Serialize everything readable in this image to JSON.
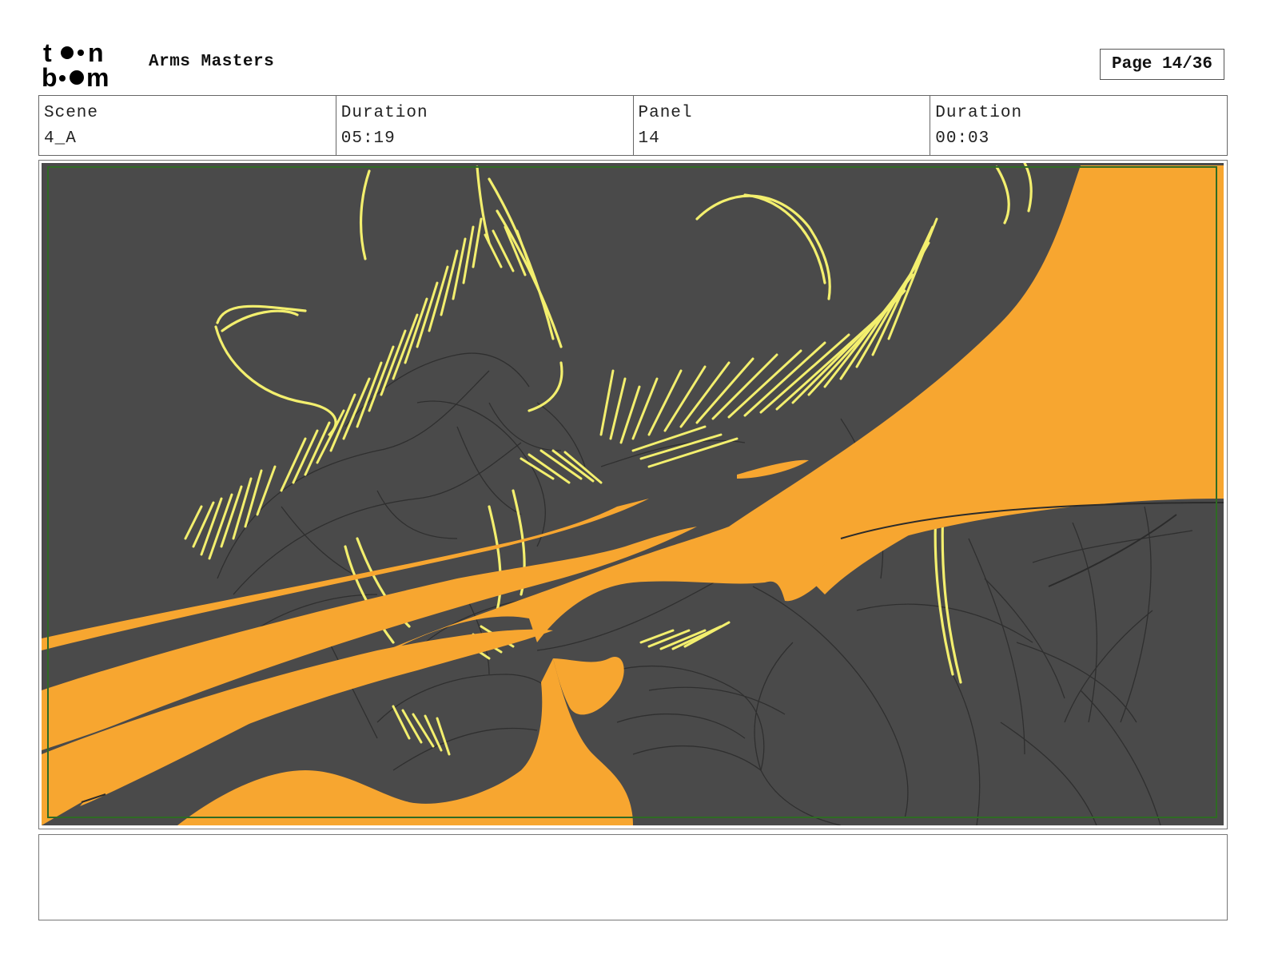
{
  "header": {
    "logo_text": "toon boom",
    "project_title": "Arms Masters",
    "page_label": "Page 14/36"
  },
  "info": {
    "scene_label": "Scene",
    "scene_value": "4_A",
    "scene_duration_label": "Duration",
    "scene_duration_value": "05:19",
    "panel_label": "Panel",
    "panel_value": "14",
    "panel_duration_label": "Duration",
    "panel_duration_value": "00:03"
  },
  "colors": {
    "background": "#4a4a4a",
    "slash": "#f7a630",
    "highlight": "#f3ef6e",
    "sketch": "#2b2b2b",
    "safe_frame": "#2f6b24"
  },
  "notes": {
    "text": ""
  }
}
